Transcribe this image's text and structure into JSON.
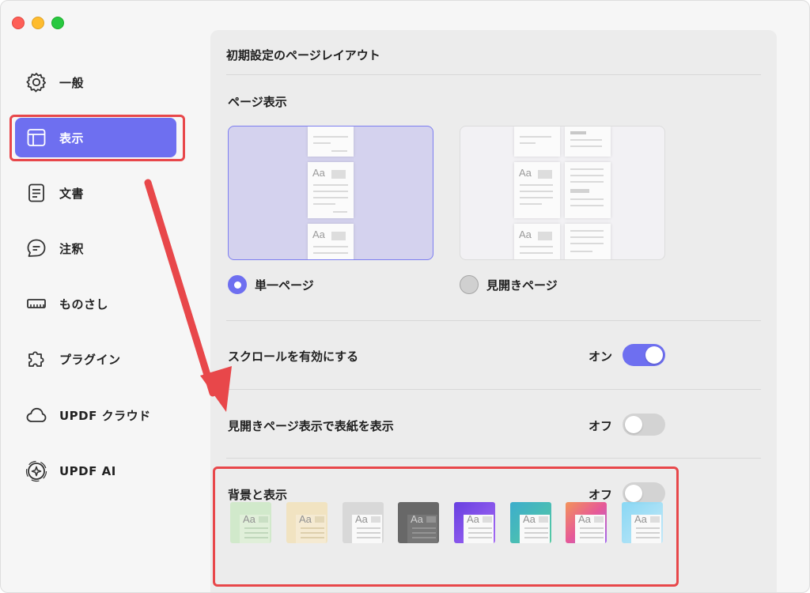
{
  "sidebar": {
    "items": [
      {
        "label": "一般",
        "icon": "gear-icon"
      },
      {
        "label": "表示",
        "icon": "layout-icon",
        "active": true
      },
      {
        "label": "文書",
        "icon": "document-icon"
      },
      {
        "label": "注釈",
        "icon": "comment-icon"
      },
      {
        "label": "ものさし",
        "icon": "ruler-icon"
      },
      {
        "label": "プラグイン",
        "icon": "puzzle-icon"
      },
      {
        "label": "UPDF クラウド",
        "icon": "cloud-icon"
      },
      {
        "label": "UPDF AI",
        "icon": "ai-icon"
      }
    ]
  },
  "panel": {
    "title": "初期設定のページレイアウト",
    "page_display": {
      "label": "ページ表示",
      "options": [
        {
          "label": "単一ページ",
          "selected": true
        },
        {
          "label": "見開きページ",
          "selected": false
        }
      ]
    },
    "scroll": {
      "label": "スクロールを有効にする",
      "status": "オン",
      "on": true
    },
    "cover": {
      "label": "見開きページ表示で表紙を表示",
      "status": "オフ",
      "on": false
    },
    "background": {
      "label": "背景と表示",
      "status": "オフ",
      "on": false,
      "swatch_text": "Aa",
      "swatches": [
        "#cfe9c8",
        "#f2e3bd",
        "#d6d6d6",
        "#5a5a5a",
        "purple-gradient",
        "teal-gradient",
        "sunset-gradient",
        "sky-gradient"
      ]
    },
    "thumbnail_text": "Aa"
  },
  "colors": {
    "accent": "#6e6ff0",
    "highlight": "#e8474a"
  }
}
